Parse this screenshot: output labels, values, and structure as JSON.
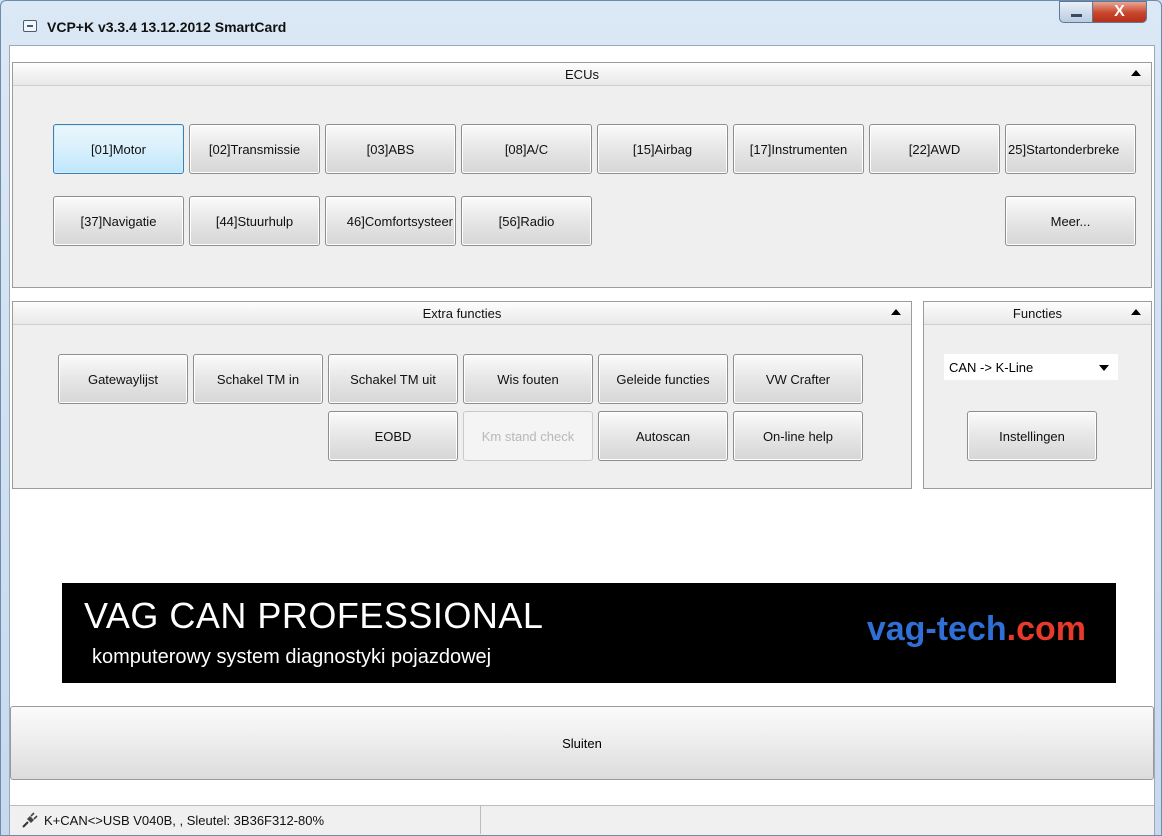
{
  "window": {
    "title": "VCP+K v3.3.4 13.12.2012 SmartCard",
    "close_glyph": "X"
  },
  "ecus": {
    "header": "ECUs",
    "row1": [
      "[01]Motor",
      "[02]Transmissie",
      "[03]ABS",
      "[08]A/C",
      "[15]Airbag",
      "[17]Instrumenten",
      "[22]AWD",
      "25]Startonderbreke"
    ],
    "row2": [
      "[37]Navigatie",
      "[44]Stuurhulp",
      "46]Comfortsysteer",
      "[56]Radio"
    ],
    "more": "Meer..."
  },
  "extra": {
    "header": "Extra functies",
    "row1": [
      "Gatewaylijst",
      "Schakel TM in",
      "Schakel TM uit",
      "Wis fouten",
      "Geleide functies",
      "VW Crafter"
    ],
    "row2": [
      "EOBD",
      "Km stand check",
      "Autoscan",
      "On-line help"
    ]
  },
  "functies": {
    "header": "Functies",
    "select_value": "CAN -> K-Line",
    "settings": "Instellingen"
  },
  "banner": {
    "title": "VAG CAN PROFESSIONAL",
    "subtitle": "komputerowy system diagnostyki pojazdowej",
    "logo_a": "vag-tech",
    "logo_b": ".com"
  },
  "close_button": "Sluiten",
  "status": {
    "text": "K+CAN<>USB V040B, , Sleutel: 3B36F312-80%"
  },
  "colors": {
    "active_button": "#bee6fd",
    "banner_bg": "#000000",
    "logo_blue": "#2f6fd6",
    "logo_red": "#e83a2a"
  }
}
